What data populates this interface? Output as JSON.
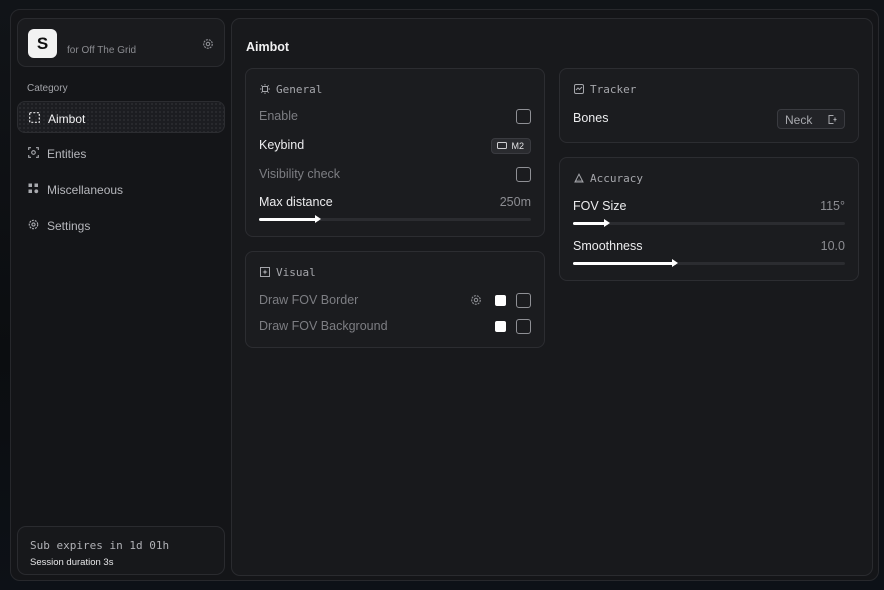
{
  "brand": {
    "logo_letter": "S",
    "subtitle": "for Off The Grid"
  },
  "sidebar": {
    "category_label": "Category",
    "items": [
      {
        "label": "Aimbot",
        "icon": "crosshair-dashed-icon",
        "active": true
      },
      {
        "label": "Entities",
        "icon": "scan-user-icon",
        "active": false
      },
      {
        "label": "Miscellaneous",
        "icon": "grid-dots-icon",
        "active": false
      },
      {
        "label": "Settings",
        "icon": "gear-icon",
        "active": false
      }
    ],
    "subscription": {
      "expires": "Sub expires in 1d 01h",
      "session": "Session duration 3s"
    }
  },
  "main": {
    "title": "Aimbot",
    "general": {
      "title": "General",
      "enable_label": "Enable",
      "enable_checked": false,
      "keybind_label": "Keybind",
      "keybind_value": "M2",
      "visibility_label": "Visibility check",
      "visibility_checked": false,
      "max_distance_label": "Max distance",
      "max_distance_value": "250m",
      "max_distance_fraction": 0.22
    },
    "visual": {
      "title": "Visual",
      "fov_border_label": "Draw FOV Border",
      "fov_border_checked": false,
      "fov_background_label": "Draw FOV Background",
      "fov_background_checked": false,
      "swatch_color": "#ffffff"
    },
    "tracker": {
      "title": "Tracker",
      "bones_label": "Bones",
      "bones_value": "Neck"
    },
    "accuracy": {
      "title": "Accuracy",
      "fov_size_label": "FOV Size",
      "fov_size_value": "115°",
      "fov_size_fraction": 0.13,
      "smoothness_label": "Smoothness",
      "smoothness_value": "10.0",
      "smoothness_fraction": 0.38
    }
  },
  "colors": {
    "accent": "#ffffff",
    "panel": "#18191c",
    "card": "#1b1c1f"
  }
}
